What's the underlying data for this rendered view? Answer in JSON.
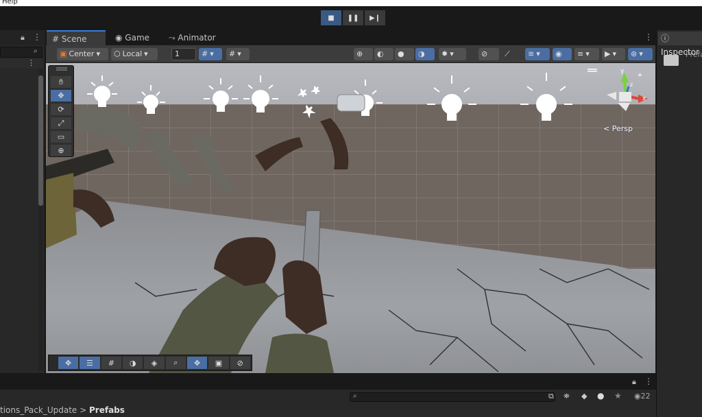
{
  "menubar": {
    "help": "Help"
  },
  "play_controls": {
    "play": "■",
    "pause": "❚❚",
    "step": "▶❙"
  },
  "tabs": {
    "scene": "Scene",
    "game": "Game",
    "animator": "Animator",
    "inspector": "Inspector"
  },
  "scene_toolbar": {
    "pivot": "Center",
    "space": "Local",
    "snap_value": "1"
  },
  "viewport": {
    "projection_label": "< Persp",
    "gizmo_axes": {
      "x": "x",
      "y": "y",
      "z": "z"
    }
  },
  "inspector": {
    "label": "Prefa"
  },
  "project_panel": {
    "breadcrumb_parent": "tions_Pack_Update",
    "breadcrumb_sep": ">",
    "breadcrumb_current": "Prefabs",
    "hidden_count": "22"
  },
  "colors": {
    "accent": "#3a7bd5",
    "active_button": "#4a6ea3",
    "x_axis": "#d94a3a",
    "y_axis": "#7bd13a",
    "z_axis": "#3a6ed9"
  }
}
